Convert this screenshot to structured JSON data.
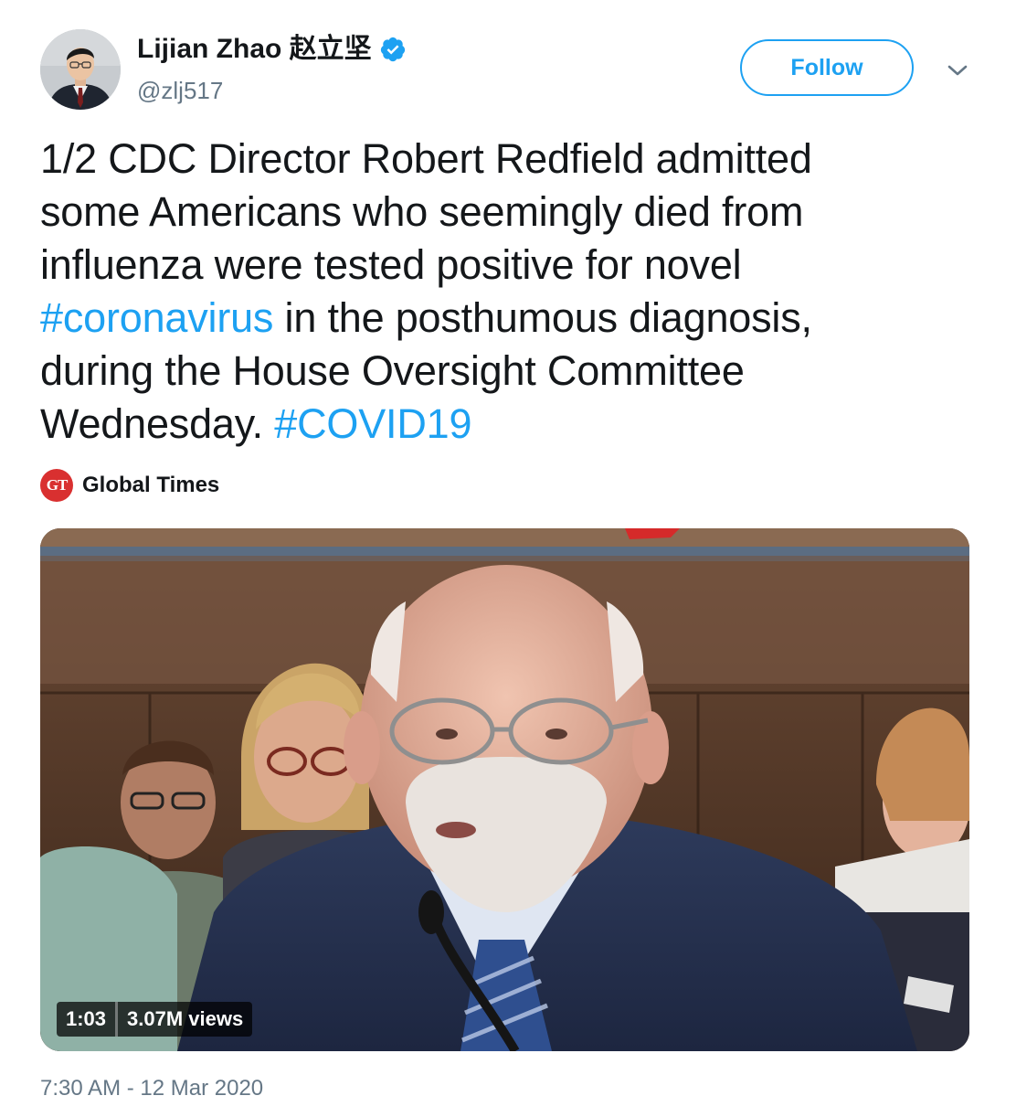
{
  "author": {
    "name": "Lijian Zhao 赵立坚",
    "handle": "@zlj517"
  },
  "follow_label": "Follow",
  "tweet": {
    "line1": "1/2 CDC Director Robert Redfield admitted",
    "line2": "some Americans who seemingly died from",
    "line3": "influenza were tested positive for novel",
    "hashtag1": "#coronavirus",
    "line4_rest": " in the posthumous diagnosis,",
    "line5": "during the House Oversight Committee",
    "line6_start": "Wednesday. ",
    "hashtag2": "#COVID19"
  },
  "source": {
    "logo_text": "GT",
    "name": "Global Times"
  },
  "video": {
    "duration": "1:03",
    "views": "3.07M views"
  },
  "timestamp": "7:30 AM - 12 Mar 2020",
  "colors": {
    "accent": "#1da1f2",
    "text": "#14171a",
    "muted": "#657786",
    "source_logo": "#d93030"
  },
  "icons": {
    "verified": "verified-badge-icon",
    "more": "chevron-down-icon"
  }
}
